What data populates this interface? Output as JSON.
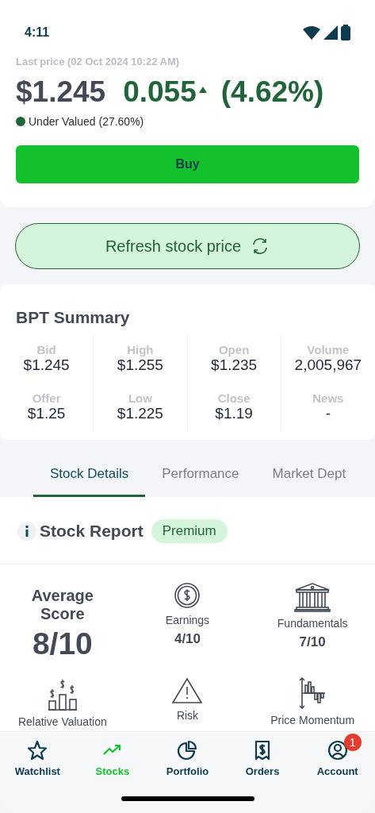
{
  "status_bar": {
    "time": "4:11"
  },
  "quote": {
    "last_price_label": "Last price (02 Oct 2024 10:22 AM)",
    "price": "$1.245",
    "change": "0.055",
    "change_rising": true,
    "change_percent": "(4.62%)",
    "valuation": {
      "text": "Under Valued (27.60%)",
      "color": "#22643a"
    }
  },
  "buy_button": "Buy",
  "refresh_button": "Refresh stock price",
  "summary": {
    "title": "BPT Summary",
    "cells": [
      {
        "label": "Bid",
        "value": "$1.245"
      },
      {
        "label": "High",
        "value": "$1.255"
      },
      {
        "label": "Open",
        "value": "$1.235"
      },
      {
        "label": "Volume",
        "value": "2,005,967"
      },
      {
        "label": "Offer",
        "value": "$1.25"
      },
      {
        "label": "Low",
        "value": "$1.225"
      },
      {
        "label": "Close",
        "value": "$1.19"
      },
      {
        "label": "News",
        "value": "-"
      }
    ]
  },
  "tabs": [
    {
      "label": "Stock Details",
      "selected": true
    },
    {
      "label": "Performance",
      "selected": false
    },
    {
      "label": "Market Dept",
      "selected": false
    }
  ],
  "report": {
    "title": "Stock Report",
    "badge": "Premium",
    "average": {
      "label": "Average Score",
      "value": "8/10"
    },
    "scores": [
      {
        "kind": "coin",
        "label": "Earnings",
        "value": "4/10"
      },
      {
        "kind": "bank",
        "label": "Fundamentals",
        "value": "7/10"
      },
      {
        "kind": "valuation",
        "label": "Relative Valuation"
      },
      {
        "kind": "warning",
        "label": "Risk"
      },
      {
        "kind": "momentum",
        "label": "Price Momentum"
      }
    ]
  },
  "nav": [
    {
      "kind": "star",
      "label": "Watchlist",
      "selected": false
    },
    {
      "kind": "trend",
      "label": "Stocks",
      "selected": true
    },
    {
      "kind": "pie",
      "label": "Portfolio",
      "selected": false
    },
    {
      "kind": "receipt",
      "label": "Orders",
      "selected": false
    },
    {
      "kind": "account",
      "label": "Account",
      "selected": false,
      "badge": "1"
    }
  ]
}
